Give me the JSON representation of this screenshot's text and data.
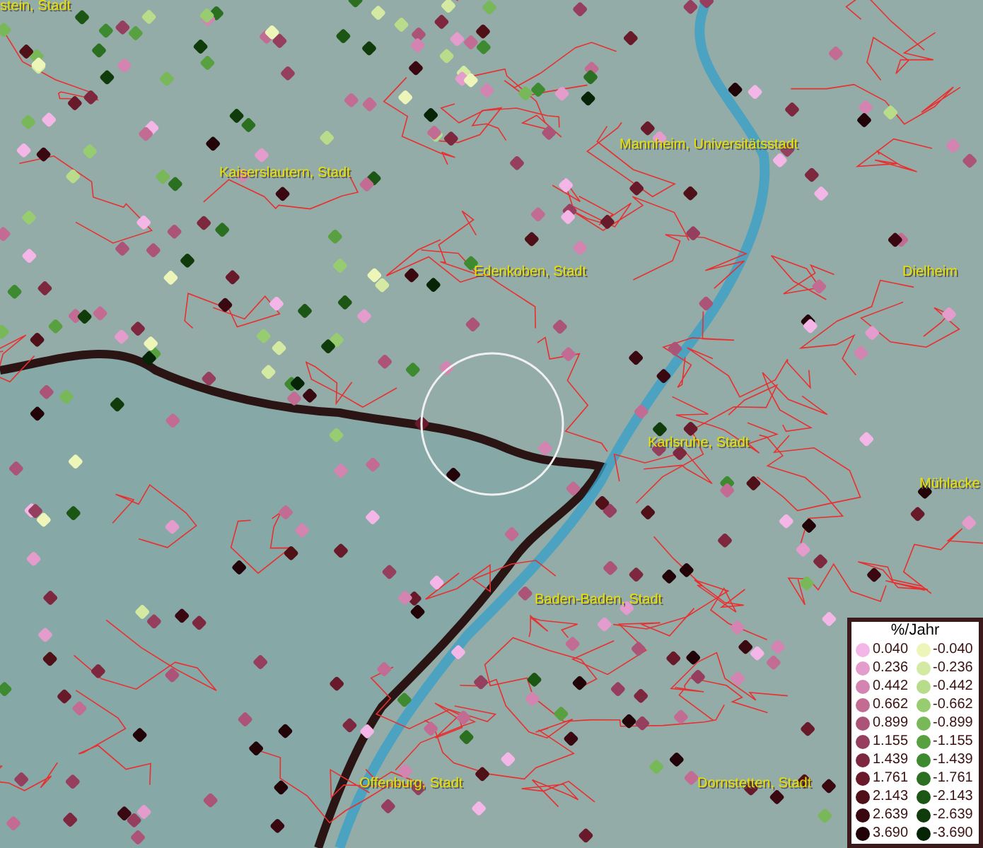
{
  "map": {
    "place_labels": [
      {
        "text": "stein, Stadt"
      },
      {
        "text": "Kaiserslautern, Stadt"
      },
      {
        "text": "Mannheim, Universitätsstadt"
      },
      {
        "text": "Edenkoben, Stadt"
      },
      {
        "text": "Dielheim"
      },
      {
        "text": "Karlsruhe, Stadt"
      },
      {
        "text": "Mühlacke"
      },
      {
        "text": "Baden-Baden, Stadt"
      },
      {
        "text": "Offenburg, Stadt"
      },
      {
        "text": "Dornstetten, Stadt"
      }
    ]
  },
  "legend": {
    "title": "%/Jahr",
    "columns": [
      [
        {
          "label": "0.040",
          "color": "#f4b6e6"
        },
        {
          "label": "0.236",
          "color": "#e49ccc"
        },
        {
          "label": "0.442",
          "color": "#d484b0"
        },
        {
          "label": "0.662",
          "color": "#c26c94"
        },
        {
          "label": "0.899",
          "color": "#ac5478"
        },
        {
          "label": "1.155",
          "color": "#963e5e"
        },
        {
          "label": "1.439",
          "color": "#7e2840"
        },
        {
          "label": "1.761",
          "color": "#681a2a"
        },
        {
          "label": "2.143",
          "color": "#501018"
        },
        {
          "label": "2.639",
          "color": "#3a0810"
        },
        {
          "label": "3.690",
          "color": "#220408"
        }
      ],
      [
        {
          "label": "-0.040",
          "color": "#eef5b8"
        },
        {
          "label": "-0.236",
          "color": "#d4eaa2"
        },
        {
          "label": "-0.442",
          "color": "#b8dc8a"
        },
        {
          "label": "-0.662",
          "color": "#98cc70"
        },
        {
          "label": "-0.899",
          "color": "#78b858"
        },
        {
          "label": "-1.155",
          "color": "#58a040"
        },
        {
          "label": "-1.439",
          "color": "#3e8a30"
        },
        {
          "label": "-1.761",
          "color": "#2a7020"
        },
        {
          "label": "-2.143",
          "color": "#1c5614"
        },
        {
          "label": "-2.639",
          "color": "#103c0c"
        },
        {
          "label": "-3.690",
          "color": "#062406"
        }
      ]
    ]
  }
}
